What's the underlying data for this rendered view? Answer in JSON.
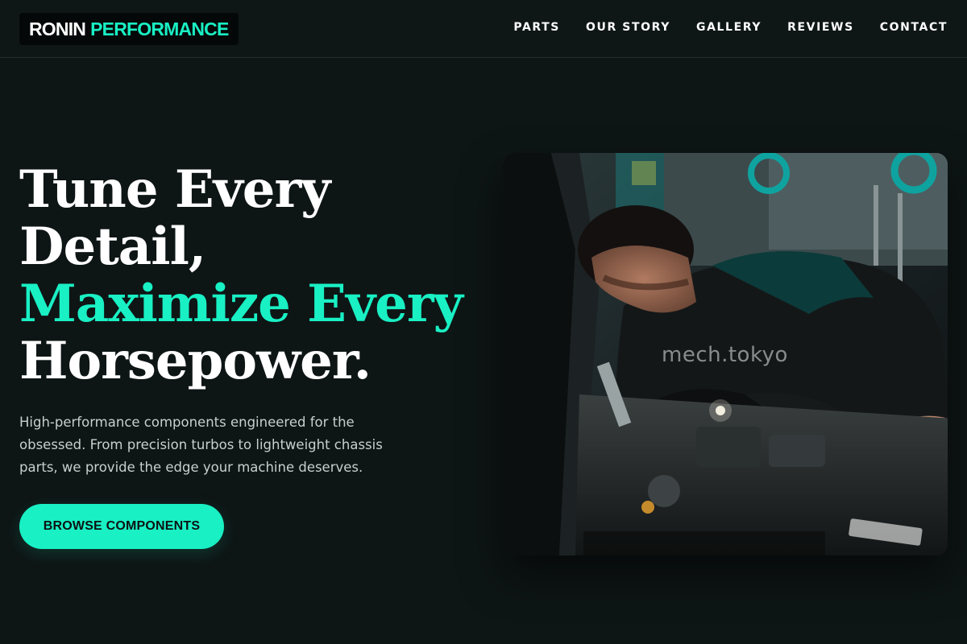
{
  "brand": {
    "name_part1": "RONIN",
    "name_part2": "PERFORMANCE",
    "accent_color": "#19f0c4",
    "background_color": "#0e1515"
  },
  "nav": {
    "items": [
      {
        "label": "PARTS"
      },
      {
        "label": "OUR STORY"
      },
      {
        "label": "GALLERY"
      },
      {
        "label": "REVIEWS"
      },
      {
        "label": "CONTACT"
      }
    ]
  },
  "hero": {
    "title_line1": "Tune Every",
    "title_line2": "Detail,",
    "title_line3": "Maximize Every",
    "title_line4": "Horsepower.",
    "subtitle": "High-performance components engineered for the obsessed. From precision turbos to lightweight chassis parts, we provide the edge your machine deserves.",
    "cta_label": "BROWSE COMPONENTS",
    "image_watermark": "mech.tokyo"
  }
}
